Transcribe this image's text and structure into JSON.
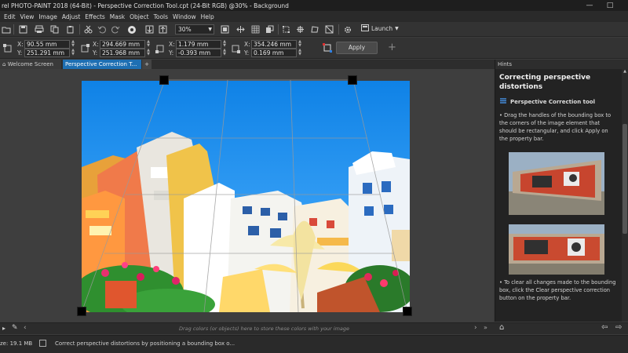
{
  "app": {
    "title": "rel PHOTO-PAINT 2018 (64-Bit) - Perspective Correction Tool.cpt (24-Bit RGB) @30% - Background"
  },
  "window_controls": {
    "minimize": "—",
    "maximize": "□"
  },
  "menu": [
    "Edit",
    "View",
    "Image",
    "Adjust",
    "Effects",
    "Mask",
    "Object",
    "Tools",
    "Window",
    "Help"
  ],
  "toolbar": {
    "zoom_value": "30%",
    "launch_label": "Launch",
    "icons": [
      "new-document-icon",
      "open-icon",
      "save-icon",
      "print-icon",
      "copy-icon",
      "paste-icon",
      "undo-icon",
      "redo-icon",
      "color-disc-icon",
      "import-icon",
      "export-icon",
      "zoom-fit-icon",
      "grid-icon",
      "mask-icon",
      "object-icon",
      "bounding-box-icon",
      "settings-icon",
      "launch-icon"
    ]
  },
  "propbar": {
    "x1_label": "X:",
    "x1": "90.55 mm",
    "y1_label": "Y:",
    "y1": "251.291 mm",
    "x2_label": "X:",
    "x2": "294.669 mm",
    "y2_label": "Y:",
    "y2": "251.968 mm",
    "x3_label": "X:",
    "x3": "1.179 mm",
    "y3_label": "Y:",
    "y3": "-0.393 mm",
    "x4_label": "X:",
    "x4": "354.246 mm",
    "y4_label": "Y:",
    "y4": "0.169 mm",
    "apply_label": "Apply",
    "add_label": "+"
  },
  "tabs": {
    "welcome": "Welcome Screen",
    "active": "Perspective Correction T...",
    "add": "+"
  },
  "hints": {
    "panel_title": "Hints",
    "heading": "Correcting perspective distortions",
    "tool_name": "Perspective Correction tool",
    "bullet1": "Drag the handles of the bounding box to the corners of the image element that should be rectangular, and click Apply on the property bar.",
    "bullet2": "To clear all changes made to the bounding box, click the Clear perspective correction button on the property bar."
  },
  "colorbar": {
    "hint": "Drag colors (or objects) here to store these colors with your image"
  },
  "status": {
    "size": "ze: 19.1 MB",
    "message": "Correct perspective distortions by positioning a bounding box o..."
  },
  "colors": {
    "accent": "#1e6fb3",
    "sky": "#1e8fe8",
    "handle": "#000000"
  }
}
